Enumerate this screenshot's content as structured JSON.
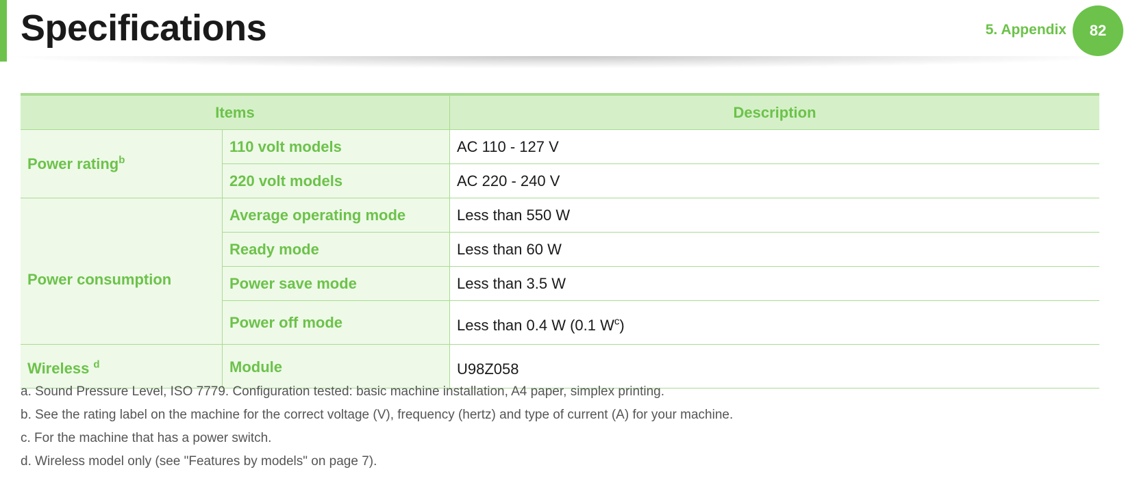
{
  "header": {
    "title": "Specifications",
    "chapter": "5.  Appendix",
    "page_number": "82",
    "accent_color": "#6cc24a"
  },
  "table": {
    "headers": {
      "items": "Items",
      "description": "Description"
    },
    "power_rating": {
      "label": "Power rating",
      "footnote_mark": "b",
      "rows": [
        {
          "item": "110 volt models",
          "value": "AC 110 - 127 V"
        },
        {
          "item": "220 volt models",
          "value": "AC 220 - 240 V"
        }
      ]
    },
    "power_consumption": {
      "label": "Power consumption",
      "rows": [
        {
          "item": "Average operating mode",
          "value": "Less than 550 W"
        },
        {
          "item": "Ready mode",
          "value": "Less than 60 W"
        },
        {
          "item": "Power save mode",
          "value": "Less than 3.5 W"
        },
        {
          "item": "Power off mode",
          "value_prefix": "Less than 0.4 W (0.1 W",
          "value_mark": "c",
          "value_suffix": ")"
        }
      ]
    },
    "wireless": {
      "label": "Wireless ",
      "footnote_mark": "d",
      "rows": [
        {
          "item": "Module",
          "value": "U98Z058"
        }
      ]
    }
  },
  "footnotes": [
    "a. Sound Pressure Level, ISO 7779. Configuration tested: basic machine installation, A4 paper, simplex printing.",
    "b. See the rating label on the machine for the correct voltage (V), frequency (hertz) and type of current (A) for your machine.",
    "c. For the machine that has a power switch.",
    "d. Wireless model only (see \"Features by models\" on page 7)."
  ]
}
